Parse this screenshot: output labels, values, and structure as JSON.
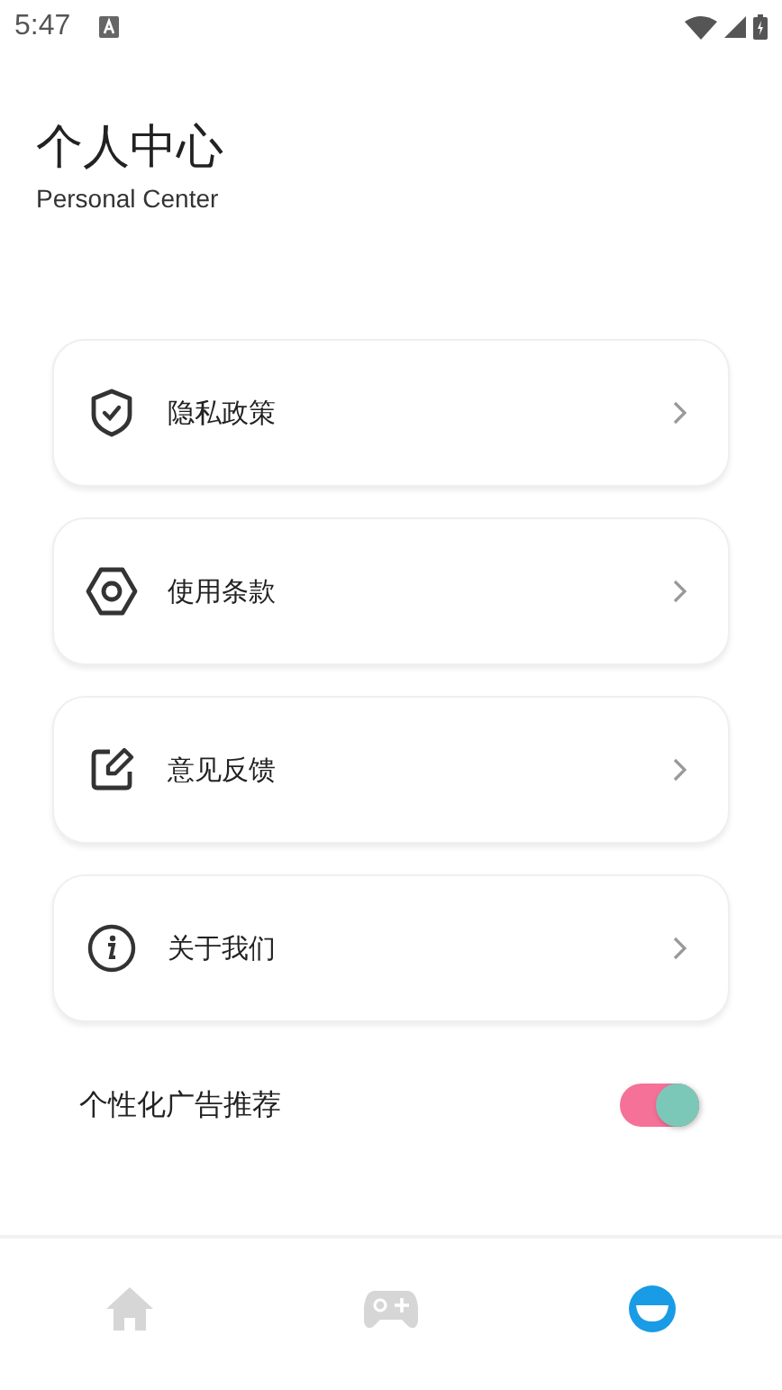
{
  "status_bar": {
    "time": "5:47"
  },
  "header": {
    "title": "个人中心",
    "subtitle": "Personal Center"
  },
  "menu": [
    {
      "label": "隐私政策",
      "kind": "shield"
    },
    {
      "label": "使用条款",
      "kind": "gear"
    },
    {
      "label": "意见反馈",
      "kind": "edit"
    },
    {
      "label": "关于我们",
      "kind": "info"
    }
  ],
  "ad_toggle": {
    "label": "个性化广告推荐",
    "on": true
  },
  "bottom_nav": [
    {
      "kind": "home",
      "selected": false
    },
    {
      "kind": "game",
      "selected": false
    },
    {
      "kind": "profile",
      "selected": true
    }
  ]
}
